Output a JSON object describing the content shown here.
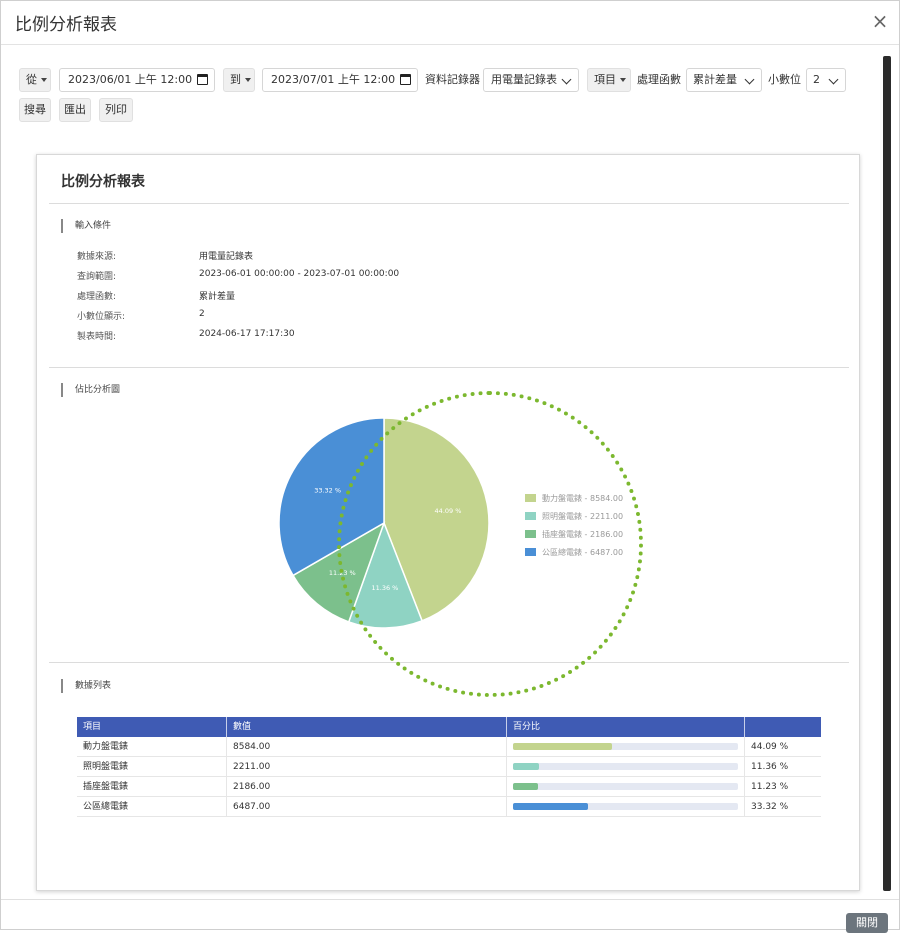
{
  "modal": {
    "title": "比例分析報表",
    "close_icon": "×"
  },
  "toolbar": {
    "from_label": "從",
    "from_date": "2023/06/01 上午 12:00",
    "to_label": "到",
    "to_date": "2023/07/01 上午 12:00",
    "recorder_label": "資料記錄器",
    "recorder_value": "用電量記錄表",
    "item_label": "項目",
    "func_label": "處理函數",
    "func_value": "累計差量",
    "decimal_label": "小數位",
    "decimal_value": "2",
    "search_label": "搜尋",
    "export_label": "匯出",
    "print_label": "列印"
  },
  "report": {
    "title": "比例分析報表",
    "input_section_title": "輸入條件",
    "info": [
      {
        "key": "數據來源:",
        "value": "用電量記錄表"
      },
      {
        "key": "查詢範圍:",
        "value": "2023-06-01 00:00:00 - 2023-07-01 00:00:00"
      },
      {
        "key": "處理函數:",
        "value": "累計差量"
      },
      {
        "key": "小數位顯示:",
        "value": "2"
      },
      {
        "key": "製表時間:",
        "value": "2024-06-17 17:17:30"
      }
    ],
    "chart_section_title": "佔比分析圖",
    "table_section_title": "數據列表",
    "table_headers": [
      "項目",
      "數值",
      "百分比",
      ""
    ]
  },
  "chart_data": {
    "type": "pie",
    "categories": [
      "動力盤電錶",
      "照明盤電錶",
      "插座盤電錶",
      "公區總電錶"
    ],
    "values": [
      8584.0,
      2211.0,
      2186.0,
      6487.0
    ],
    "percentages": [
      44.09,
      11.36,
      11.23,
      33.32
    ],
    "value_labels": [
      "8584.00",
      "2211.00",
      "2186.00",
      "6487.00"
    ],
    "percent_labels": [
      "44.09 %",
      "11.36 %",
      "11.23 %",
      "33.32 %"
    ],
    "colors": [
      "#c3d48e",
      "#8fd3c3",
      "#7cc08c",
      "#4a8fd6"
    ],
    "legend_position": "right"
  },
  "footer": {
    "close_label": "關閉"
  }
}
